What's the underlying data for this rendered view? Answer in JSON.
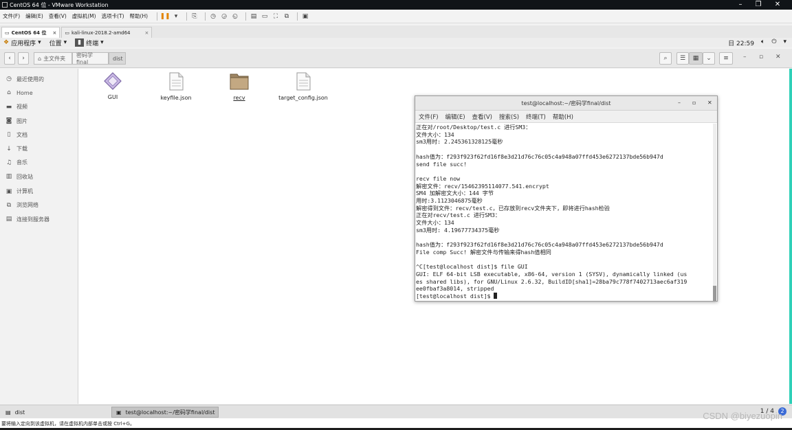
{
  "vmware": {
    "title": "CentOS 64 位 - VMware Workstation",
    "menu": [
      "文件(F)",
      "编辑(E)",
      "查看(V)",
      "虚拟机(M)",
      "选项卡(T)",
      "帮助(H)"
    ],
    "tabs": [
      {
        "label": "CentOS 64 位",
        "active": true
      },
      {
        "label": "kali-linux-2018.2-amd64",
        "active": false
      }
    ]
  },
  "gnome": {
    "applications": "应用程序",
    "places": "位置",
    "terminal": "终端",
    "clock": "日 22:59"
  },
  "nautilus": {
    "breadcrumb": [
      "主文件夹",
      "密码学final",
      "dist"
    ],
    "sidebar": [
      {
        "icon": "clock-icon",
        "label": "最近使用的"
      },
      {
        "icon": "home-icon",
        "label": "Home"
      },
      {
        "icon": "video-icon",
        "label": "视频"
      },
      {
        "icon": "camera-icon",
        "label": "图片"
      },
      {
        "icon": "document-icon",
        "label": "文档"
      },
      {
        "icon": "download-icon",
        "label": "下载"
      },
      {
        "icon": "music-icon",
        "label": "音乐"
      },
      {
        "icon": "trash-icon",
        "label": "回收站"
      },
      {
        "icon": "computer-icon",
        "label": "计算机"
      },
      {
        "icon": "network-icon",
        "label": "浏览网络"
      },
      {
        "icon": "server-icon",
        "label": "连接到服务器"
      }
    ],
    "files": [
      {
        "name": "GUI",
        "type": "executable"
      },
      {
        "name": "keyfile.json",
        "type": "document"
      },
      {
        "name": "recv",
        "type": "folder"
      },
      {
        "name": "target_config.json",
        "type": "document"
      }
    ]
  },
  "terminal": {
    "title": "test@localhost:~/密码学final/dist",
    "menu": [
      "文件(F)",
      "编辑(E)",
      "查看(V)",
      "搜索(S)",
      "终端(T)",
      "帮助(H)"
    ],
    "lines": [
      "正在对/root/Desktop/test.c 进行SM3：",
      "文件大小：134",
      "sm3用时: 2.245361328125毫秒",
      "",
      "hash值为：f293f923f62fd16f8e3d21d76c76c05c4a948a07ffd453e6272137bde56b947d",
      "send file succ!",
      "",
      "recv file now",
      "解密文件：recv/15462395114077.541.encrypt",
      "SM4 加解密文大小：144 字节",
      "用时:3.1123046875毫秒",
      "解密得到文件：recv/test.c，已存放到recv文件夹下，即将进行hash检验",
      "正在对recv/test.c 进行SM3：",
      "文件大小：134",
      "sm3用时: 4.19677734375毫秒",
      "",
      "hash值为：f293f923f62fd16f8e3d21d76c76c05c4a948a07ffd453e6272137bde56b947d",
      "File comp Succ! 解密文件与传输来得hash值相同",
      "",
      "^C[test@localhost dist]$ file GUI",
      "GUI: ELF 64-bit LSB executable, x86-64, version 1 (SYSV), dynamically linked (us",
      "es shared libs), for GNU/Linux 2.6.32, BuildID[sha1]=28ba79c778f7402713aec6af319",
      "ee0fbaf3a8014, stripped",
      "[test@localhost dist]$ "
    ]
  },
  "taskbar": {
    "items": [
      "dist",
      "test@localhost:~/密码学final/dist"
    ],
    "pager": "1 / 4",
    "pager_badge": "2"
  },
  "statusbar": {
    "hint": "要将输入定向到该虚拟机，请在虚拟机内部单击或按 Ctrl+G。"
  },
  "watermark": "CSDN @biyezuopin",
  "colors": {
    "accent_right_edge": "#2fd0b8",
    "pause": "#e28400"
  }
}
